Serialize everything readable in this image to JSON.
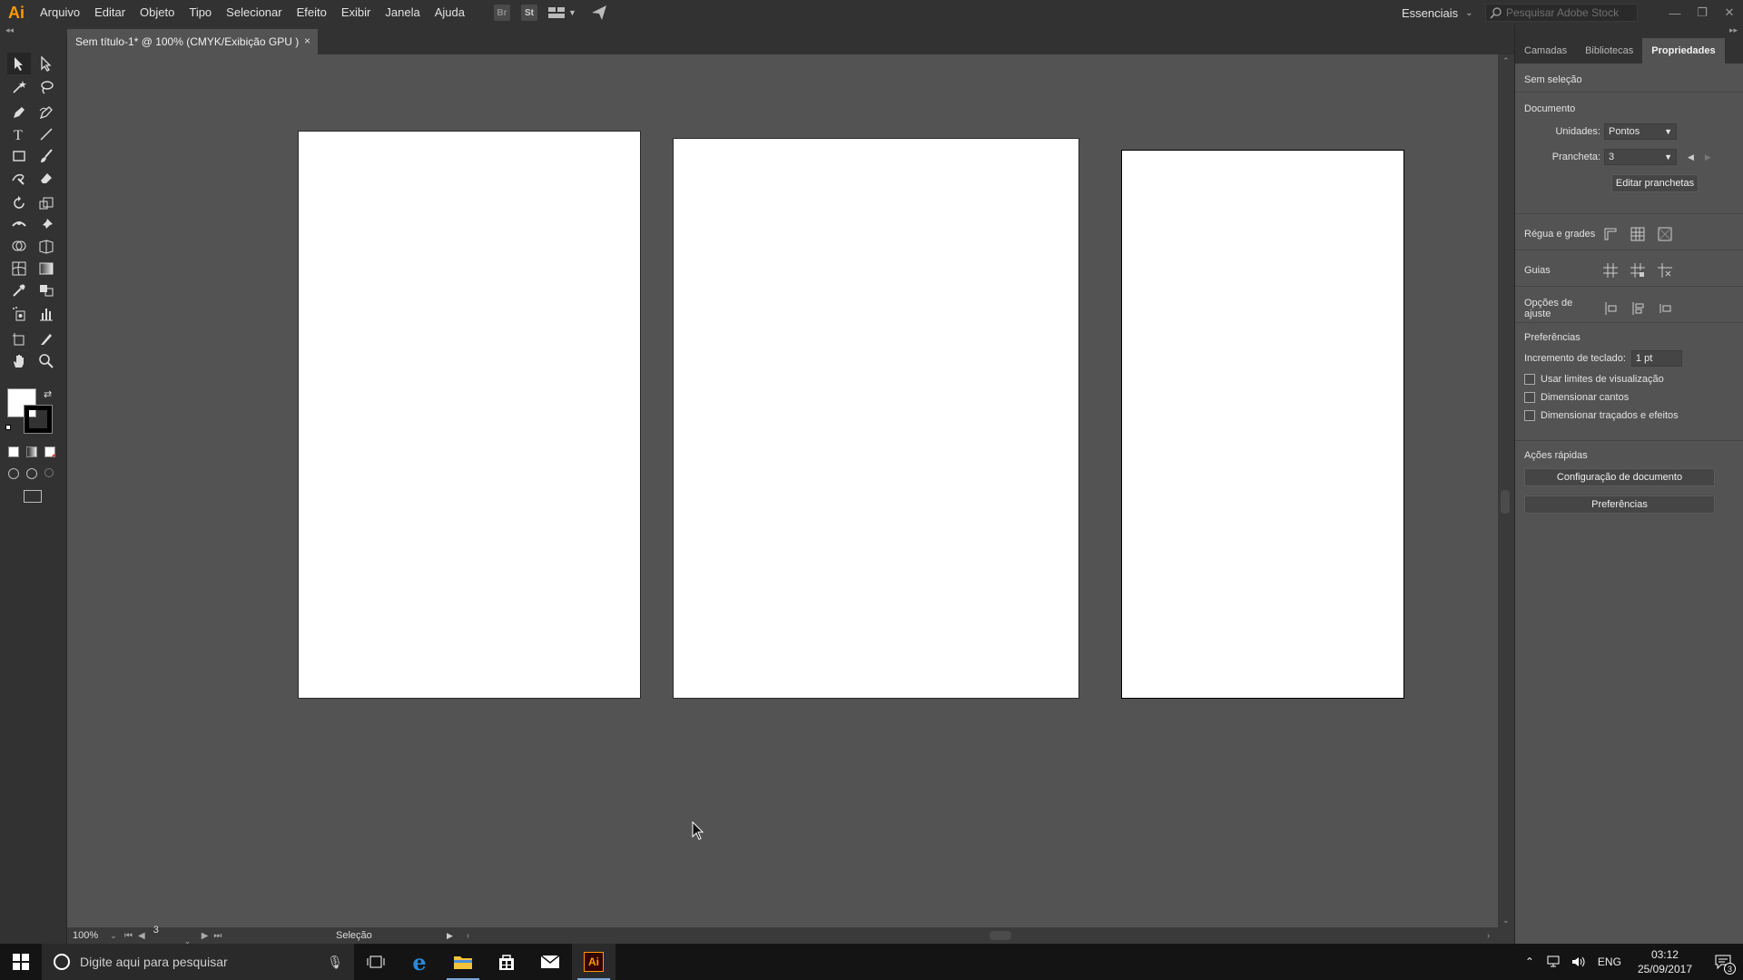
{
  "app": {
    "logo": "Ai"
  },
  "menu": [
    "Arquivo",
    "Editar",
    "Objeto",
    "Tipo",
    "Selecionar",
    "Efeito",
    "Exibir",
    "Janela",
    "Ajuda"
  ],
  "menubar_icons": {
    "bridge": "Br",
    "stock": "St"
  },
  "workspace": {
    "label": "Essenciais"
  },
  "stock_search": {
    "placeholder": "Pesquisar Adobe Stock"
  },
  "document": {
    "tab_title": "Sem título-1* @ 100% (CMYK/Exibição GPU )",
    "close": "×"
  },
  "status": {
    "zoom": "100%",
    "artboard_number": "3",
    "mode": "Seleção"
  },
  "panel": {
    "tabs": [
      "Camadas",
      "Bibliotecas",
      "Propriedades"
    ],
    "active_tab": "Propriedades",
    "no_selection": "Sem seleção",
    "document_header": "Documento",
    "units_label": "Unidades:",
    "units_value": "Pontos",
    "artboard_label": "Prancheta:",
    "artboard_value": "3",
    "edit_artboards": "Editar pranchetas",
    "rulers_grids": "Régua e grades",
    "guides": "Guias",
    "snap_options": "Opções de ajuste",
    "preferences_header": "Preferências",
    "keyboard_increment_label": "Incremento de teclado:",
    "keyboard_increment_value": "1 pt",
    "checkboxes": [
      "Usar limites de visualização",
      "Dimensionar cantos",
      "Dimensionar traçados e efeitos"
    ],
    "quick_actions": "Ações rápidas",
    "doc_setup_button": "Configuração de documento",
    "preferences_button": "Preferências"
  },
  "taskbar": {
    "search_placeholder": "Digite aqui para pesquisar",
    "language": "ENG",
    "time": "03:12",
    "date": "25/09/2017",
    "notification_count": "3",
    "pinned_apps": [
      "edge-icon",
      "file-explorer-icon",
      "store-icon",
      "mail-icon",
      "illustrator-icon"
    ],
    "illustrator_label": "Ai"
  },
  "colors": {
    "accent_ai": "#ff9a00",
    "ui_dark": "#323232",
    "canvas": "#535353"
  }
}
